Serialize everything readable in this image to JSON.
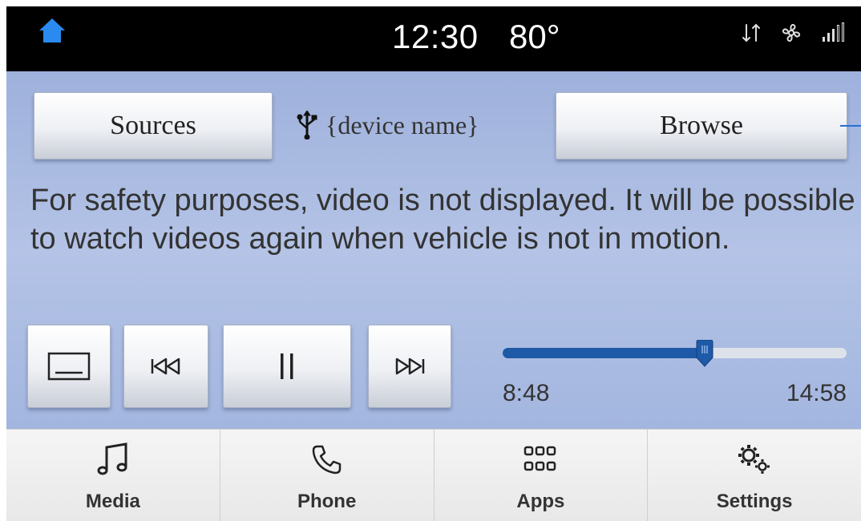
{
  "status_bar": {
    "time": "12:30",
    "temperature": "80°",
    "icons": [
      "home-icon",
      "data-transfer-icon",
      "climate-fan-icon",
      "signal-strength-icon"
    ],
    "home_color": "#2a8af0"
  },
  "header": {
    "sources_label": "Sources",
    "device_icon": "usb-icon",
    "device_name": "{device name}",
    "browse_label": "Browse"
  },
  "message": "For safety purposes, video is not displayed. It will be possible to watch videos again when vehicle is not in motion.",
  "controls": {
    "buttons": [
      "screen-toggle-icon",
      "previous-track-icon",
      "pause-icon",
      "next-track-icon"
    ]
  },
  "playback": {
    "elapsed": "8:48",
    "total": "14:58",
    "progress_fraction": 0.588,
    "fill_color": "#1e5aa8"
  },
  "bottom_nav": [
    {
      "label": "Media",
      "icon": "music-note-icon"
    },
    {
      "label": "Phone",
      "icon": "phone-icon"
    },
    {
      "label": "Apps",
      "icon": "apps-grid-icon"
    },
    {
      "label": "Settings",
      "icon": "settings-gears-icon"
    }
  ]
}
